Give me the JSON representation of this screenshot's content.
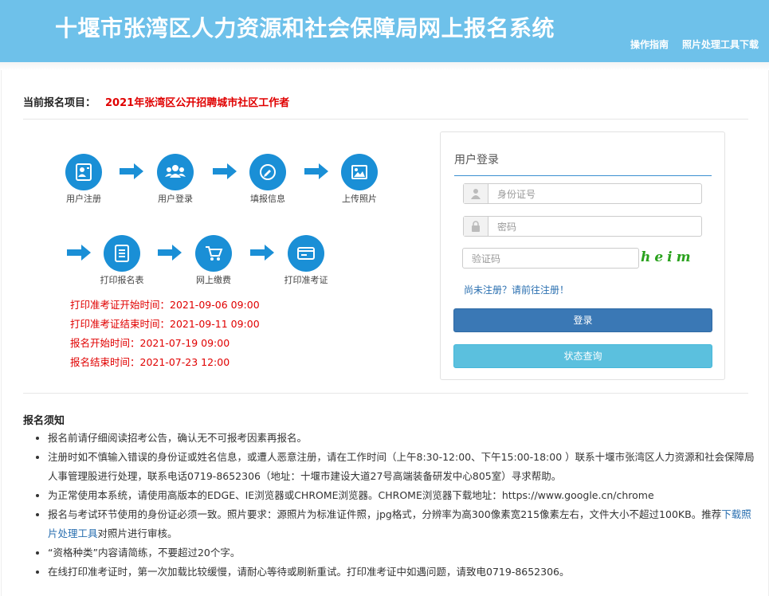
{
  "header": {
    "title": "十堰市张湾区人力资源和社会保障局网上报名系统",
    "links": [
      "操作指南",
      "照片处理工具下载"
    ]
  },
  "project": {
    "label": "当前报名项目：",
    "name": "2021年张湾区公开招聘城市社区工作者"
  },
  "flow": {
    "steps": [
      "用户注册",
      "用户登录",
      "填报信息",
      "上传照片",
      "打印报名表",
      "网上缴费",
      "打印准考证"
    ]
  },
  "times": [
    "打印准考证开始时间：2021-09-06 09:00",
    "打印准考证结束时间：2021-09-11 09:00",
    "报名开始时间：2021-07-19 09:00",
    "报名结束时间：2021-07-23 12:00"
  ],
  "login": {
    "title": "用户登录",
    "id_placeholder": "身份证号",
    "password_placeholder": "密码",
    "captcha_placeholder": "验证码",
    "captcha_text": "heim",
    "register_link": "尚未注册？请前往注册！",
    "login_button": "登录",
    "status_button": "状态查询"
  },
  "notice": {
    "title": "报名须知",
    "items": [
      "报名前请仔细阅读招考公告，确认无不可报考因素再报名。",
      "注册时如不慎输入错误的身份证或姓名信息，或遭人恶意注册，请在工作时间（上午8:30-12:00、下午15:00-18:00 ）联系十堰市张湾区人力资源和社会保障局人事管理股进行处理，联系电话0719-8652306（地址：十堰市建设大道27号高端装备研发中心805室）寻求帮助。",
      "为正常使用本系统，请使用高版本的EDGE、IE浏览器或CHROME浏览器。CHROME浏览器下载地址：https://www.google.cn/chrome",
      "“资格种类”内容请简练，不要超过20个字。",
      "在线打印准考证时，第一次加载比较缓慢，请耐心等待或刷新重试。打印准考证中如遇问题，请致电0719-8652306。"
    ],
    "photo_item_before": "报名与考试环节使用的身份证必须一致。照片要求：源照片为标准证件照，jpg格式，分辨率为高300像素宽215像素左右，文件大小不超过100KB。推荐",
    "photo_item_link": "下载照片处理工具",
    "photo_item_after": "对照片进行审核。"
  },
  "colors": {
    "header_bg": "#6ec1ea",
    "step_circle": "#1a8fd6",
    "alert_red": "#e00000",
    "login_button": "#3a78b5",
    "status_button": "#5bc0de"
  }
}
